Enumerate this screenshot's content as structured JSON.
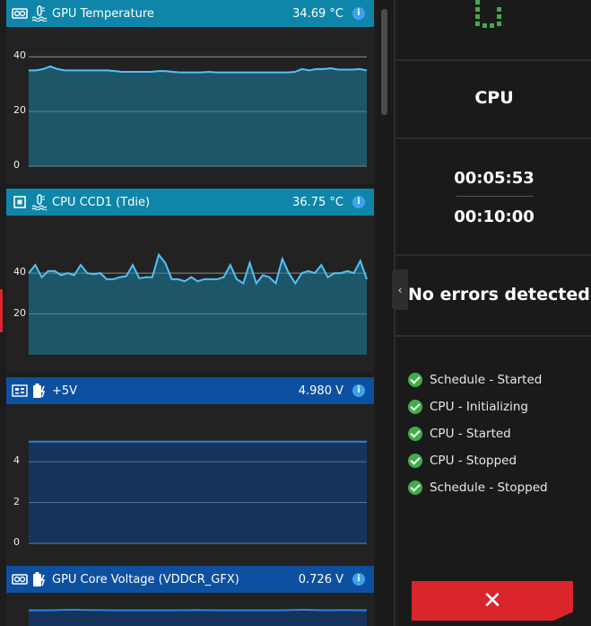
{
  "sensors": [
    {
      "label": "GPU Temperature",
      "value": "34.69 °C",
      "header_color": "#0f86a9",
      "line_color": "#4fc3f7",
      "fill_color": "#1d5a6e",
      "ymax": 45,
      "ticks": [
        "40",
        "20",
        "0"
      ],
      "tick_values": [
        40,
        20,
        0
      ],
      "series": [
        35,
        35,
        35.5,
        36.5,
        35.5,
        35,
        35,
        35,
        35,
        35,
        35,
        35,
        34.8,
        34.5,
        34.5,
        34.5,
        34.5,
        34.5,
        34.8,
        34.8,
        34.5,
        34.3,
        34.3,
        34.3,
        34.3,
        34.5,
        34.3,
        34.3,
        34.3,
        34.3,
        34.3,
        34.3,
        34.3,
        34.3,
        34.3,
        34.3,
        34.3,
        34.5,
        35.5,
        35,
        35.5,
        35.5,
        35.8,
        35.3,
        35.3,
        35.3,
        35.5,
        35
      ]
    },
    {
      "label": "CPU CCD1 (Tdie)",
      "value": "36.75 °C",
      "header_color": "#0f86a9",
      "line_color": "#4fc3f7",
      "fill_color": "#1d5a6e",
      "ymax": 55,
      "ticks": [
        "40",
        "20"
      ],
      "tick_values": [
        40,
        20
      ],
      "series": [
        40,
        44,
        38,
        41,
        41,
        39,
        40,
        39,
        44,
        40,
        39.5,
        40,
        37,
        37,
        38,
        38.5,
        44,
        37.5,
        38,
        38,
        49,
        45,
        37,
        37,
        36,
        38,
        36,
        37,
        37,
        37,
        38,
        44,
        37,
        35,
        45,
        35,
        39,
        38,
        35,
        47,
        40,
        35,
        40,
        41,
        40,
        44,
        38,
        40,
        40,
        41,
        40,
        46,
        37
      ]
    },
    {
      "label": "+5V",
      "value": "4.980 V",
      "header_color": "#0d50a0",
      "line_color": "#2f82e0",
      "fill_color": "#16365f",
      "ymax": 5.5,
      "ticks": [
        "4",
        "2",
        "0"
      ],
      "tick_values": [
        4,
        2,
        0
      ],
      "series": [
        4.98,
        4.98,
        4.98,
        4.98,
        4.98,
        4.98,
        4.98,
        4.98,
        4.98,
        4.98,
        4.98,
        4.98
      ]
    },
    {
      "label": "GPU Core Voltage (VDDCR_GFX)",
      "value": "0.726 V",
      "header_color": "#0d50a0",
      "line_color": "#2f82e0",
      "fill_color": "#16365f",
      "ymax": 0.8,
      "ticks": [],
      "tick_values": [],
      "series": [
        0.72,
        0.72,
        0.73,
        0.725,
        0.72,
        0.72,
        0.72,
        0.72,
        0.725,
        0.72,
        0.72,
        0.72,
        0.72,
        0.73,
        0.72,
        0.725,
        0.72
      ]
    }
  ],
  "right": {
    "title": "CPU",
    "elapsed": "00:05:53",
    "total": "00:10:00",
    "status": "No errors detected",
    "collapse_glyph": "‹",
    "log": [
      "Schedule - Started",
      "CPU - Initializing",
      "CPU - Started",
      "CPU - Stopped",
      "Schedule - Stopped"
    ],
    "stop_glyph": "✕",
    "info_glyph": "i"
  },
  "colors": {
    "accent_red": "#d9252b",
    "success": "#3fae49",
    "spinner": "#3fae49"
  }
}
